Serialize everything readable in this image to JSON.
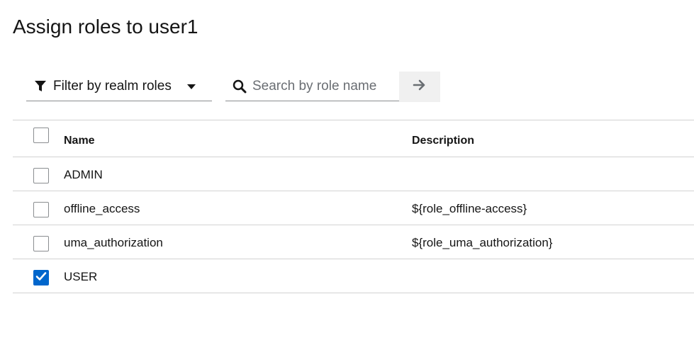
{
  "page": {
    "title": "Assign roles to user1"
  },
  "toolbar": {
    "filter_label": "Filter by realm roles",
    "search_placeholder": "Search by role name",
    "search_value": ""
  },
  "table": {
    "columns": {
      "name": "Name",
      "description": "Description"
    },
    "rows": [
      {
        "name": "ADMIN",
        "description": "",
        "checked": false
      },
      {
        "name": "offline_access",
        "description": "${role_offline-access}",
        "checked": false
      },
      {
        "name": "uma_authorization",
        "description": "${role_uma_authorization}",
        "checked": false
      },
      {
        "name": "USER",
        "description": "",
        "checked": true
      }
    ]
  },
  "colors": {
    "accent": "#0066cc",
    "border": "#d2d2d2",
    "text": "#151515"
  },
  "icons": {
    "filter": "filter-icon",
    "caret": "caret-down-icon",
    "search": "search-icon",
    "go": "arrow-right-icon",
    "check": "check-icon"
  }
}
